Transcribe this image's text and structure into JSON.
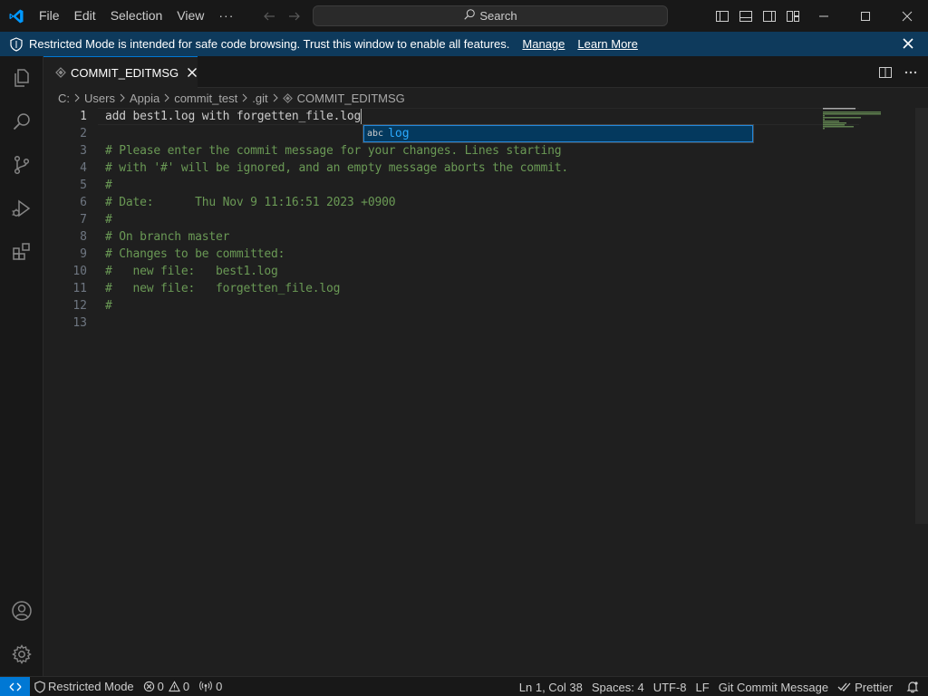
{
  "titlebar": {
    "menu": [
      "File",
      "Edit",
      "Selection",
      "View"
    ],
    "more": "···",
    "search_label": "Search"
  },
  "banner": {
    "message": "Restricted Mode is intended for safe code browsing. Trust this window to enable all features.",
    "manage": "Manage",
    "learn_more": "Learn More",
    "background": "#0e3a5c"
  },
  "activity_bar": {
    "top": [
      "explorer-icon",
      "search-icon",
      "source-control-icon",
      "run-debug-icon",
      "extensions-icon"
    ],
    "bottom": [
      "accounts-icon",
      "manage-gear-icon"
    ]
  },
  "tab": {
    "label": "COMMIT_EDITMSG",
    "accent": "#0078d4"
  },
  "breadcrumb": [
    "C:",
    "Users",
    "Appia",
    "commit_test",
    ".git",
    "COMMIT_EDITMSG"
  ],
  "editor": {
    "lines": [
      {
        "n": "1",
        "text": "add best1.log with forgetten_file.log",
        "comment": false
      },
      {
        "n": "2",
        "text": "",
        "comment": false
      },
      {
        "n": "3",
        "text": "# Please enter the commit message for your changes. Lines starting",
        "comment": true
      },
      {
        "n": "4",
        "text": "# with '#' will be ignored, and an empty message aborts the commit.",
        "comment": true
      },
      {
        "n": "5",
        "text": "#",
        "comment": true
      },
      {
        "n": "6",
        "text": "# Date:      Thu Nov 9 11:16:51 2023 +0900",
        "comment": true
      },
      {
        "n": "7",
        "text": "#",
        "comment": true
      },
      {
        "n": "8",
        "text": "# On branch master",
        "comment": true
      },
      {
        "n": "9",
        "text": "# Changes to be committed:",
        "comment": true
      },
      {
        "n": "10",
        "text": "#   new file:   best1.log",
        "comment": true
      },
      {
        "n": "11",
        "text": "#   new file:   forgetten_file.log",
        "comment": true
      },
      {
        "n": "12",
        "text": "#",
        "comment": true
      },
      {
        "n": "13",
        "text": "",
        "comment": false
      }
    ],
    "comment_color": "#6a9955"
  },
  "suggest": {
    "kind": "abc",
    "word": "log"
  },
  "statusbar": {
    "restricted": "Restricted Mode",
    "errors": "0",
    "warnings": "0",
    "ports": "0",
    "position": "Ln 1, Col 38",
    "spaces": "Spaces: 4",
    "encoding": "UTF-8",
    "eol": "LF",
    "language": "Git Commit Message",
    "prettier": "Prettier"
  }
}
